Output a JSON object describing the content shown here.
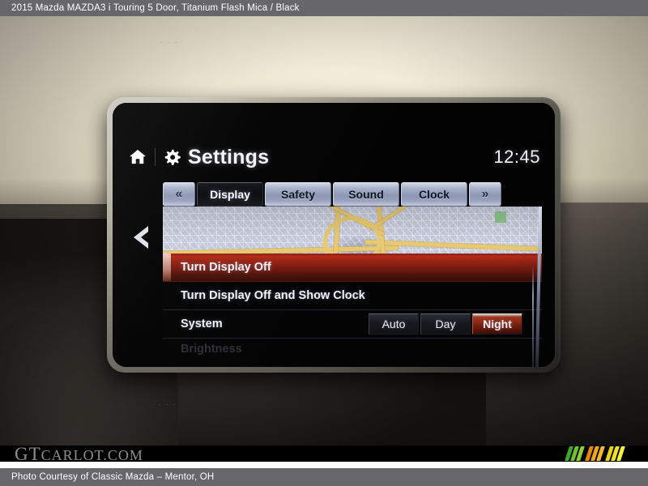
{
  "titlebar": {
    "vehicle": "2015 Mazda MAZDA3 i Touring 5 Door,",
    "colors": "Titanium Flash Mica / Black",
    "full": "2015 Mazda MAZDA3 i Touring 5 Door,  Titanium Flash Mica / Black"
  },
  "infotainment": {
    "home_icon": "home-icon",
    "gear_icon": "gear-icon",
    "title": "Settings",
    "clock": "12:45",
    "back_icon": "chevron-left-icon",
    "tabs": [
      {
        "label": "«",
        "name": "tab-prev",
        "selected": false,
        "kind": "nav"
      },
      {
        "label": "Display",
        "name": "tab-display",
        "selected": true,
        "kind": "wide"
      },
      {
        "label": "Safety",
        "name": "tab-safety",
        "selected": false,
        "kind": "wide"
      },
      {
        "label": "Sound",
        "name": "tab-sound",
        "selected": false,
        "kind": "wide"
      },
      {
        "label": "Clock",
        "name": "tab-clock",
        "selected": false,
        "kind": "wide"
      },
      {
        "label": "»",
        "name": "tab-next",
        "selected": false,
        "kind": "nav"
      }
    ],
    "rows": [
      {
        "label": "Turn Display Off",
        "highlighted": true
      },
      {
        "label": "Turn Display Off and Show Clock",
        "highlighted": false
      },
      {
        "label": "System",
        "highlighted": false,
        "options": [
          {
            "label": "Auto",
            "selected": false
          },
          {
            "label": "Day",
            "selected": false
          },
          {
            "label": "Night",
            "selected": true
          }
        ]
      },
      {
        "label": "Brightness",
        "highlighted": false,
        "partial": true
      }
    ]
  },
  "watermark": {
    "part1": "GT",
    "part2": "CARLOT",
    "part3": ".COM",
    "stripe_colors": [
      "#3fa82a",
      "#6dc22f",
      "#8fd02f",
      "#e08a12",
      "#f0a521",
      "#f5b72d",
      "#e8d317",
      "#f0e327",
      "#f7ef3a"
    ]
  },
  "footer": {
    "credit": "Photo Courtesy of Classic Mazda – Mentor, OH"
  },
  "theme": {
    "bar_bg": "#67676a",
    "highlight_red": "#8a2512",
    "tab_blue": "#9aa4bf",
    "screen_black": "#040405"
  }
}
